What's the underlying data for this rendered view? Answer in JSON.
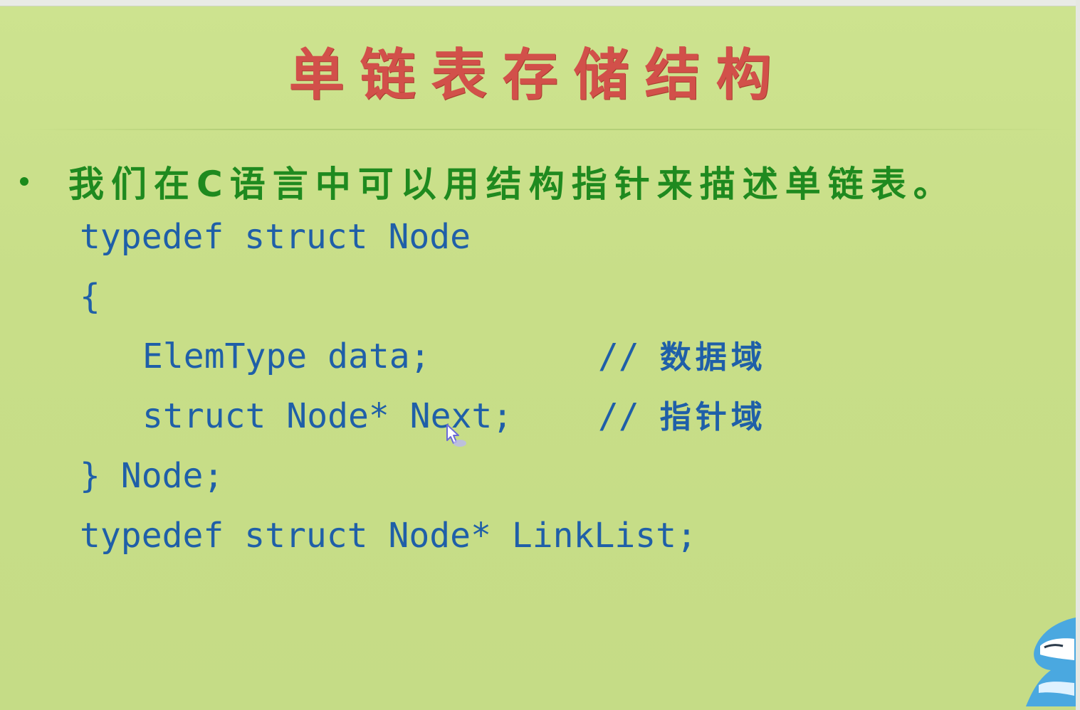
{
  "slide": {
    "title": "单链表存储结构",
    "bullet": "我们在C语言中可以用结构指针来描述单链表。",
    "code": {
      "line1": "typedef struct Node",
      "line2": "{",
      "line3_code": "ElemType data;",
      "line3_comment_slashes": "//",
      "line3_comment_text": "数据域",
      "line4_code": "struct Node* Next;",
      "line4_comment_slashes": "//",
      "line4_comment_text": "指针域",
      "line5": "} Node;",
      "line6": "typedef struct Node* LinkList;"
    }
  },
  "colors": {
    "background": "#c8de8a",
    "title": "#d2504a",
    "bullet_text": "#1f8a1f",
    "code": "#1f5fa8"
  },
  "icons": {
    "cursor": "hand-pointer-icon",
    "mascot": "shark-mascot-icon"
  }
}
